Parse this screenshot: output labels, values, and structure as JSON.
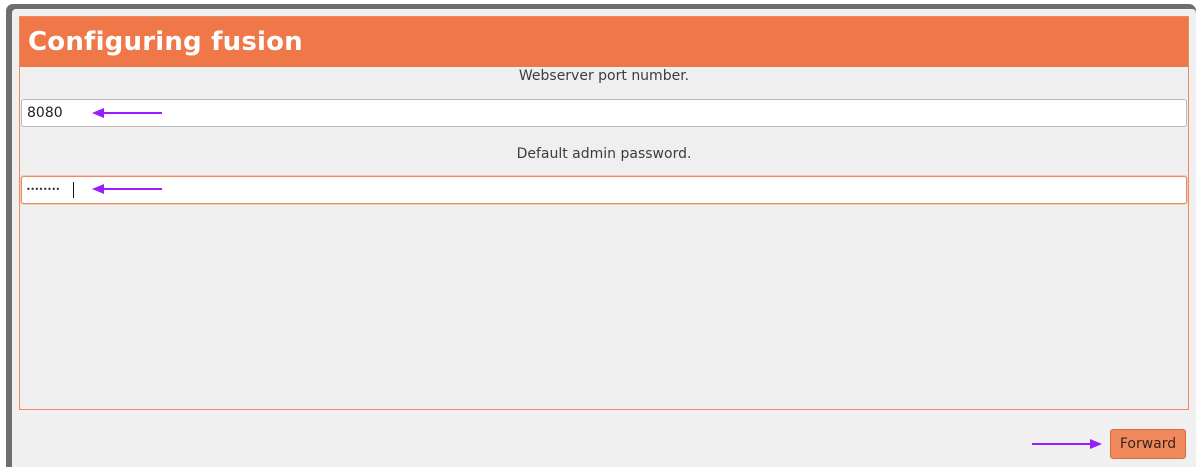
{
  "window": {
    "title": "Configuring fusion"
  },
  "form": {
    "port_label": "Webserver port number.",
    "port_value": "8080",
    "password_label": "Default admin password.",
    "password_masked": "••••••••"
  },
  "buttons": {
    "forward_label": "Forward"
  },
  "annotations": {
    "arrow_color": "#9b1cff",
    "icon": "arrow-icon"
  },
  "colors": {
    "accent": "#f07747",
    "button": "#f08a5d"
  }
}
